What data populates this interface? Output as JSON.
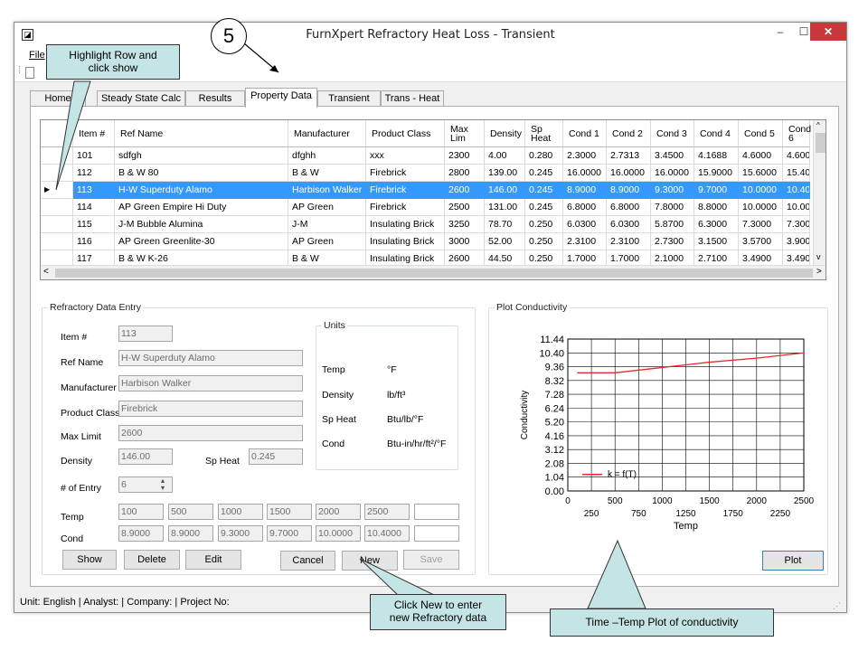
{
  "window": {
    "title": "FurnXpert Refractory Heat Loss - Transient",
    "minimize": "–",
    "maximize": "☐",
    "close": "✕"
  },
  "menu": {
    "file": "File"
  },
  "tabs": [
    "Home",
    "Steady State Calc",
    "Results",
    "Property Data",
    "Transient",
    "Trans - Heat"
  ],
  "grid": {
    "headers": [
      "Item #",
      "Ref Name",
      "Manufacturer",
      "Product Class",
      "Max Lim",
      "Density",
      "Sp Heat",
      "Cond 1",
      "Cond 2",
      "Cond 3",
      "Cond 4",
      "Cond 5",
      "Cond 6"
    ],
    "rows": [
      [
        "101",
        "sdfgh",
        "dfghh",
        "xxx",
        "2300",
        "4.00",
        "0.280",
        "2.3000",
        "2.7313",
        "3.4500",
        "4.1688",
        "4.6000",
        "4.6000"
      ],
      [
        "112",
        "B & W 80",
        "B & W",
        "Firebrick",
        "2800",
        "139.00",
        "0.245",
        "16.0000",
        "16.0000",
        "16.0000",
        "15.9000",
        "15.6000",
        "15.400"
      ],
      [
        "113",
        "H-W Superduty Alamo",
        "Harbison Walker",
        "Firebrick",
        "2600",
        "146.00",
        "0.245",
        "8.9000",
        "8.9000",
        "9.3000",
        "9.7000",
        "10.0000",
        "10.400"
      ],
      [
        "114",
        "AP Green Empire Hi Duty",
        "AP Green",
        "Firebrick",
        "2500",
        "131.00",
        "0.245",
        "6.8000",
        "6.8000",
        "7.8000",
        "8.8000",
        "10.0000",
        "10.000"
      ],
      [
        "115",
        "J-M Bubble Alumina",
        "J-M",
        "Insulating Brick",
        "3250",
        "78.70",
        "0.250",
        "6.0300",
        "6.0300",
        "5.8700",
        "6.3000",
        "7.3000",
        "7.3000"
      ],
      [
        "116",
        "AP Green Greenlite-30",
        "AP Green",
        "Insulating Brick",
        "3000",
        "52.00",
        "0.250",
        "2.3100",
        "2.3100",
        "2.7300",
        "3.1500",
        "3.5700",
        "3.9000"
      ],
      [
        "117",
        "B & W K-26",
        "B & W",
        "Insulating Brick",
        "2600",
        "44.50",
        "0.250",
        "1.7000",
        "1.7000",
        "2.1000",
        "2.7100",
        "3.4900",
        "3.4900"
      ]
    ],
    "selected_row": 2
  },
  "entry": {
    "group_title": "Refractory Data Entry",
    "item_label": "Item #",
    "item_value": "113",
    "refname_label": "Ref Name",
    "refname_value": "H-W Superduty Alamo",
    "manufacturer_label": "Manufacturer",
    "manufacturer_value": "Harbison Walker",
    "productclass_label": "Product Class",
    "productclass_value": "Firebrick",
    "maxlimit_label": "Max Limit",
    "maxlimit_value": "2600",
    "density_label": "Density",
    "density_value": "146.00",
    "spheat_label": "Sp Heat",
    "spheat_value": "0.245",
    "entries_label": "# of Entry",
    "entries_value": "6",
    "temp_label": "Temp",
    "temp_values": [
      "100",
      "500",
      "1000",
      "1500",
      "2000",
      "2500",
      ""
    ],
    "cond_label": "Cond",
    "cond_values": [
      "8.9000",
      "8.9000",
      "9.3000",
      "9.7000",
      "10.0000",
      "10.4000",
      ""
    ]
  },
  "units": {
    "group_title": "Units",
    "temp_label": "Temp",
    "temp_unit": "°F",
    "density_label": "Density",
    "density_unit": "lb/ft³",
    "spheat_label": "Sp Heat",
    "spheat_unit": "Btu/lb/°F",
    "cond_label": "Cond",
    "cond_unit": "Btu-in/hr/ft²/°F"
  },
  "buttons": {
    "show": "Show",
    "delete": "Delete",
    "edit": "Edit",
    "cancel": "Cancel",
    "new": "New",
    "save": "Save",
    "plot": "Plot"
  },
  "plot_group_title": "Plot Conductivity",
  "chart_data": {
    "type": "line",
    "title": "",
    "xlabel": "Temp",
    "ylabel": "Conductivity",
    "xlim": [
      0,
      2500
    ],
    "ylim": [
      0,
      11.44
    ],
    "x_ticks": [
      "0",
      "250",
      "500",
      "750",
      "1000",
      "1250",
      "1500",
      "1750",
      "2000",
      "2250",
      "2500"
    ],
    "y_ticks": [
      "0.00",
      "1.04",
      "2.08",
      "3.12",
      "4.16",
      "5.20",
      "6.24",
      "7.28",
      "8.32",
      "9.36",
      "10.40",
      "11.44"
    ],
    "series": [
      {
        "name": "k = f(T)",
        "color": "#e8282a",
        "x": [
          100,
          500,
          1000,
          1500,
          2000,
          2500
        ],
        "y": [
          8.9,
          8.9,
          9.3,
          9.7,
          10.0,
          10.4
        ]
      }
    ],
    "grid": true,
    "legend": "bottom-left"
  },
  "statusbar": "Unit: English   | Analyst:    | Company:    | Project No:",
  "callouts": {
    "step_number": "5",
    "highlight": "Highlight Row  and\nclick show",
    "new": "Click New to enter\nnew Refractory data",
    "plot": "Time –Temp Plot of conductivity"
  }
}
